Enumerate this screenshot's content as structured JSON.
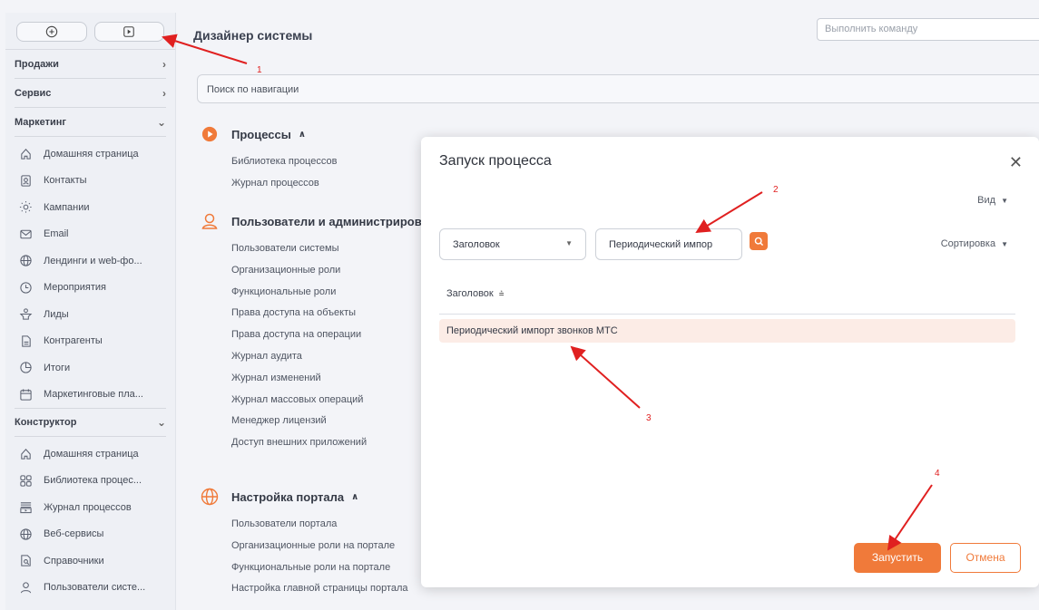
{
  "sidebar": {
    "top_buttons": [
      {
        "icon": "plus-circle-icon"
      },
      {
        "icon": "play-square-icon"
      }
    ],
    "groups": {
      "sales": {
        "label": "Продажи"
      },
      "service": {
        "label": "Сервис"
      },
      "marketing": {
        "label": "Маркетинг"
      },
      "constructor": {
        "label": "Конструктор"
      }
    },
    "marketing_items": [
      {
        "label": "Домашняя страница",
        "icon": "home-icon"
      },
      {
        "label": "Контакты",
        "icon": "contacts-icon"
      },
      {
        "label": "Кампании",
        "icon": "campaign-icon"
      },
      {
        "label": "Email",
        "icon": "mail-icon"
      },
      {
        "label": "Лендинги и web-фо...",
        "icon": "globe-icon"
      },
      {
        "label": "Мероприятия",
        "icon": "clock-icon"
      },
      {
        "label": "Лиды",
        "icon": "leads-icon"
      },
      {
        "label": "Контрагенты",
        "icon": "document-icon"
      },
      {
        "label": "Итоги",
        "icon": "pie-chart-icon"
      },
      {
        "label": "Маркетинговые пла...",
        "icon": "calendar-icon"
      }
    ],
    "constructor_items": [
      {
        "label": "Домашняя страница",
        "icon": "home-icon"
      },
      {
        "label": "Библиотека процес...",
        "icon": "process-library-icon"
      },
      {
        "label": "Журнал процессов",
        "icon": "process-log-icon"
      },
      {
        "label": "Веб-сервисы",
        "icon": "web-services-icon"
      },
      {
        "label": "Справочники",
        "icon": "lookups-icon"
      },
      {
        "label": "Пользователи систе...",
        "icon": "user-icon"
      }
    ]
  },
  "header": {
    "title": "Дизайнер системы",
    "command_placeholder": "Выполнить команду"
  },
  "nav_search": {
    "placeholder": "Поиск по навигации"
  },
  "sections": {
    "processes": {
      "title": "Процессы",
      "links": [
        "Библиотека процессов",
        "Журнал процессов"
      ]
    },
    "users": {
      "title": "Пользователи и администрирован",
      "links": [
        "Пользователи системы",
        "Организационные роли",
        "Функциональные роли",
        "Права доступа на объекты",
        "Права доступа на операции",
        "Журнал аудита",
        "Журнал изменений",
        "Журнал массовых операций",
        "Менеджер лицензий",
        "Доступ внешних приложений"
      ]
    },
    "portal": {
      "title": "Настройка портала",
      "links": [
        "Пользователи портала",
        "Организационные роли на портале",
        "Функциональные роли на портале",
        "Настройка главной страницы портала"
      ]
    }
  },
  "modal": {
    "title": "Запуск процесса",
    "view_label": "Вид",
    "sort_label": "Сортировка",
    "filter_field": "Заголовок",
    "filter_value": "Периодический импор",
    "column_header": "Заголовок",
    "selected_row": "Периодический импорт звонков МТС",
    "run_label": "Запустить",
    "cancel_label": "Отмена"
  },
  "annotations": [
    "1",
    "2",
    "3",
    "4"
  ],
  "colors": {
    "accent": "#f07a3a",
    "selected_row": "#fcece6",
    "annotation": "#e02020"
  }
}
